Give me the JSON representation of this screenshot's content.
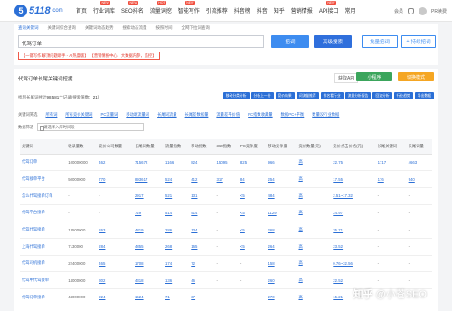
{
  "site": {
    "logo_glyph": "5",
    "logo_text": "5118",
    "logo_domain": ".com"
  },
  "nav": [
    {
      "label": "首页",
      "badge": ""
    },
    {
      "label": "行业词库",
      "badge": "NEW"
    },
    {
      "label": "SEO排名",
      "badge": "NEW"
    },
    {
      "label": "流量词挖",
      "badge": "HOT"
    },
    {
      "label": "智能写作",
      "badge": "NEW"
    },
    {
      "label": "引流推荐",
      "badge": ""
    },
    {
      "label": "抖音榜",
      "badge": ""
    },
    {
      "label": "抖音",
      "badge": ""
    },
    {
      "label": "知乎",
      "badge": ""
    },
    {
      "label": "营销情报",
      "badge": ""
    },
    {
      "label": "API接口",
      "badge": "NEW"
    },
    {
      "label": "常用",
      "badge": ""
    }
  ],
  "topright": {
    "member": "会员",
    "recharge": "PR续费"
  },
  "search": {
    "tabs": [
      "查询关键词",
      "关键词综合查询",
      "关键词动态趋势",
      "搜索动态流量",
      "按照时间",
      "全网下拉词查询"
    ],
    "value": "代驾订单",
    "btn_search": "挖词",
    "btn_advanced": "高级搜索",
    "btn_batch": "批量挖词",
    "btn_stock": "持续挖词",
    "promo_a": "【一键写作 解顶问题助手 - AI热度版】",
    "promo_b": "【营销情报中心，大数据内参，监控】"
  },
  "main": {
    "title": "代驾订单长尾关键词挖掘",
    "api": "获取API",
    "assist": "小程序",
    "mode": "切换模式",
    "result_prefix": "找到长尾词共计",
    "result_count": "98,581",
    "result_mid": "个记录(搜索值数：",
    "result_rank": "21",
    "result_suffix": "]"
  },
  "actions": [
    "移动分类分析",
    "分析上一份",
    "竞价结果",
    "词流量推荐",
    "排名看行业",
    "流量分析报告",
    "回流分析",
    "行业趋势",
    "导出数据"
  ],
  "filters": {
    "label": "关键词筛选",
    "options": [
      "所有词",
      "所有竞价关键词",
      "PC流量词",
      "移动端流量词",
      "长尾词流量",
      "长尾差数据量",
      "流量差平价值",
      "PC指数收藏量",
      "数据PC+平衡",
      "数量没行业数据"
    ],
    "scope_label": "数据筛选",
    "scope_value": "请选择入库时间段"
  },
  "table": {
    "headers": [
      "关键词",
      "收录量数",
      "竞价公司数量",
      "长尾词数量",
      "流量指数",
      "移动指数",
      "360指数",
      "PC竞争度",
      "移动竞争度",
      "竞价数量(元)",
      "竞价点击价格(元)",
      "长尾关键词",
      "长尾词量"
    ],
    "rows": [
      [
        "代驾订单",
        "100000000",
        "462",
        "715672",
        "1166",
        "824",
        "15095",
        "825",
        "966",
        "高",
        "22.75",
        "1717",
        "4663"
      ],
      [
        "代驾接单平台",
        "50000000",
        "770",
        "893617",
        "524",
        "412",
        "317",
        "84",
        "254",
        "高",
        "17.55",
        "176",
        "940"
      ],
      [
        "怎么代驾接单订单",
        "-",
        "-",
        "2917",
        "521",
        "131",
        "-",
        "<5",
        "484",
        "高",
        "2.51~17.32",
        "-",
        "-"
      ],
      [
        "代驾平台接单",
        "-",
        "-",
        "729",
        "514",
        "514",
        "-",
        "<5",
        "1129",
        "高",
        "24.97",
        "-",
        "-"
      ],
      [
        "代驾代驾接单",
        "13500000",
        "263",
        "4819",
        "286",
        "134",
        "-",
        "<5",
        "268",
        "高",
        "35.71",
        "-",
        "-"
      ],
      [
        "上海代驾接单",
        "7130000",
        "284",
        "4855",
        "268",
        "165",
        "-",
        "<5",
        "264",
        "高",
        "23.52",
        "-",
        "-"
      ],
      [
        "代驾司机接单",
        "22400000",
        "465",
        "1708",
        "174",
        "72",
        "-",
        "-",
        "158",
        "高",
        "0.76~32.56",
        "-",
        "-"
      ],
      [
        "代驾中代驾接单",
        "14000000",
        "302",
        "4318",
        "136",
        "46",
        "-",
        "-",
        "260",
        "高",
        "22.52",
        "-",
        "-"
      ],
      [
        "代驾订单接单",
        "44000000",
        "224",
        "1524",
        "71",
        "37",
        "-",
        "-",
        "270",
        "高",
        "15.21",
        "-",
        "-"
      ]
    ]
  },
  "watermark": {
    "zh": "知乎",
    "handle": "@小苍SEO"
  },
  "colors": {
    "brand": "#2b6fd6",
    "primary_btn": "#3d8cf0",
    "assist_green": "#3ba55c",
    "mode_orange": "#f5a623",
    "promo_red": "#e0362a"
  }
}
